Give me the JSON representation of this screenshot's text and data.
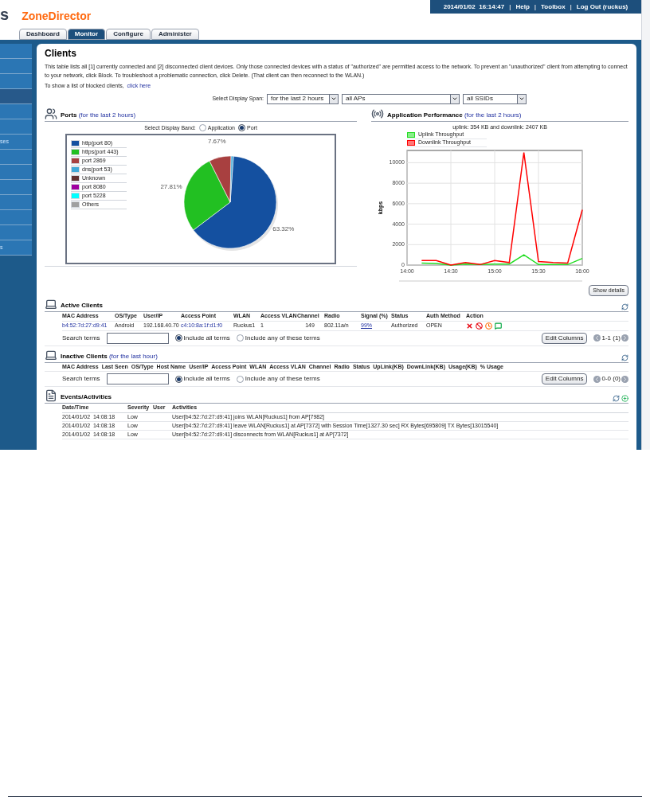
{
  "header": {
    "logo_fragment": "s",
    "product": "ZoneDirector",
    "datetime": "2014/01/02  16:14:47",
    "links": [
      "Help",
      "Toolbox",
      "Log Out (ruckus)"
    ],
    "separator": "|"
  },
  "tabs": [
    {
      "label": "Dashboard",
      "selected": false
    },
    {
      "label": "Monitor",
      "selected": true
    },
    {
      "label": "Configure",
      "selected": false
    },
    {
      "label": "Administer",
      "selected": false
    }
  ],
  "sidebar": {
    "items": [
      {
        "selected": false
      },
      {
        "selected": false
      },
      {
        "selected": false
      },
      {
        "selected": true
      },
      {
        "selected": false
      },
      {
        "selected": false
      },
      {
        "label": "ses",
        "selected": false
      },
      {
        "selected": false
      },
      {
        "selected": false
      },
      {
        "selected": false
      },
      {
        "selected": false
      },
      {
        "selected": false
      },
      {
        "selected": false
      },
      {
        "label": "s",
        "selected": false
      }
    ]
  },
  "page": {
    "title": "Clients",
    "description": "This table lists all [1] currently connected and [2] disconnected client devices. Only those connected devices with a status of \"authorized\" are permitted access to the network. To prevent an \"unauthorized\" client from attempting to connect to your network, click Block. To troubleshoot a problematic connection, click Delete. (That client can then reconnect to the WLAN.)",
    "blocked_text": "To show a list of blocked clients,",
    "blocked_link": "click here"
  },
  "filters": {
    "label": "Select Display Span:",
    "selects": [
      "for the last 2 hours",
      "all APs",
      "all SSIDs"
    ]
  },
  "ports": {
    "title": "Ports",
    "title_suffix": "(for the last 2 hours)",
    "band_label": "Select Display Band:",
    "band_options": [
      {
        "label": "Application",
        "selected": false
      },
      {
        "label": "Port",
        "selected": true
      }
    ],
    "chart_data": {
      "type": "pie",
      "categories": [
        "http(port 80)",
        "https(port 443)",
        "port 2869",
        "dns(port 53)",
        "Unknown",
        "port 8080",
        "port 5228",
        "Others"
      ],
      "colors": [
        "#1450a0",
        "#22c022",
        "#a84040",
        "#40a8d8",
        "#603030",
        "#a000a0",
        "#00ffff",
        "#a0a0a0"
      ],
      "values": [
        63.32,
        27.81,
        7.67,
        0.8,
        null,
        null,
        null,
        null
      ],
      "legend": true,
      "value_labels": [
        "63.32%",
        "27.81%",
        "7.67%",
        null,
        null,
        null,
        null,
        null
      ]
    }
  },
  "performance": {
    "title": "Application Performance",
    "title_suffix": "(for the last 2 hours)",
    "summary": "uplink: 354 KB and downlink: 2407 KB",
    "chart_data": {
      "type": "line",
      "ylabel": "kbps",
      "legend": true,
      "grid": true,
      "categories": [
        "14:00",
        null,
        null,
        "14:30",
        null,
        null,
        "15:00",
        null,
        null,
        "15:30",
        null,
        null,
        "16:00"
      ],
      "ylim": [
        0,
        11200
      ],
      "yticks": [
        0,
        2000,
        4000,
        6000,
        8000,
        10000
      ],
      "series": [
        {
          "name": "Uplink Throughput",
          "color": "#22dd22",
          "values": [
            null,
            200,
            150,
            0,
            100,
            50,
            100,
            100,
            1000,
            50,
            50,
            50,
            650
          ]
        },
        {
          "name": "Downlink Throughput",
          "color": "#ff0000",
          "values": [
            null,
            450,
            450,
            0,
            250,
            50,
            450,
            250,
            11000,
            350,
            250,
            200,
            5400
          ]
        }
      ]
    },
    "button": "Show details"
  },
  "active_clients": {
    "title": "Active Clients",
    "columns": [
      "MAC Address",
      "OS/Type",
      "User/IP",
      "Access Point",
      "WLAN",
      "Access VLAN",
      "Channel",
      "Radio",
      "Signal (%)",
      "Status",
      "Auth Method",
      "Action"
    ],
    "rows": [
      {
        "mac": "b4:52:7d:27:d9:41",
        "os": "Android",
        "ip": "192.168.40.70",
        "ap": "c4:10:8a:1f:d1:f0",
        "wlan": "Ruckus1",
        "vlan": "1",
        "channel": "149",
        "radio": "802.11a/n",
        "signal": "99%",
        "status": "Authorized",
        "auth": "OPEN"
      }
    ],
    "search_label": "Search terms",
    "search_options": [
      {
        "label": "Include all terms",
        "selected": true
      },
      {
        "label": "Include any of these terms",
        "selected": false
      }
    ],
    "edit_button": "Edit Columns",
    "pager": "1-1 (1)"
  },
  "inactive_clients": {
    "title": "Inactive Clients",
    "title_suffix": "(for the last hour)",
    "columns": [
      "MAC Address",
      "Last Seen",
      "OS/Type",
      "Host Name",
      "User/IP",
      "Access Point",
      "WLAN",
      "Access VLAN",
      "Channel",
      "Radio",
      "Status",
      "UpLink(KB)",
      "DownLink(KB)",
      "Usage(KB)",
      "% Usage"
    ],
    "search_label": "Search terms",
    "search_options": [
      {
        "label": "Include all terms",
        "selected": true
      },
      {
        "label": "Include any of these terms",
        "selected": false
      }
    ],
    "edit_button": "Edit Columns",
    "pager": "0-0 (0)"
  },
  "events": {
    "title": "Events/Activities",
    "columns": [
      "Date/Time",
      "Severity",
      "User",
      "Activities"
    ],
    "rows": [
      {
        "date": "2014/01/02  14:08:18",
        "severity": "Low",
        "activity": "User[b4:52:7d:27:d9:41] joins WLAN[Ruckus1] from AP[7982]"
      },
      {
        "date": "2014/01/02  14:08:18",
        "severity": "Low",
        "activity": "User[b4:52:7d:27:d9:41] leave WLAN[Ruckus1] at AP[7372] with Session Time[1327.30 sec] RX Bytes[695809] TX Bytes[13015540]"
      },
      {
        "date": "2014/01/02  14:08:18",
        "severity": "Low",
        "activity": "User[b4:52:7d:27:d9:41] disconnects from WLAN[Ruckus1] at AP[7372]"
      }
    ]
  }
}
